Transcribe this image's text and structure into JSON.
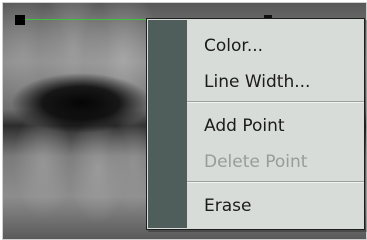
{
  "canvas": {
    "image": "dental-xray"
  },
  "overlay": {
    "line_color": "#3fc33f"
  },
  "context_menu": {
    "items": [
      {
        "label": "Color...",
        "enabled": true
      },
      {
        "label": "Line Width...",
        "enabled": true
      },
      {
        "label": "Add Point",
        "enabled": true
      },
      {
        "label": "Delete Point",
        "enabled": false
      },
      {
        "label": "Erase",
        "enabled": true
      }
    ]
  }
}
